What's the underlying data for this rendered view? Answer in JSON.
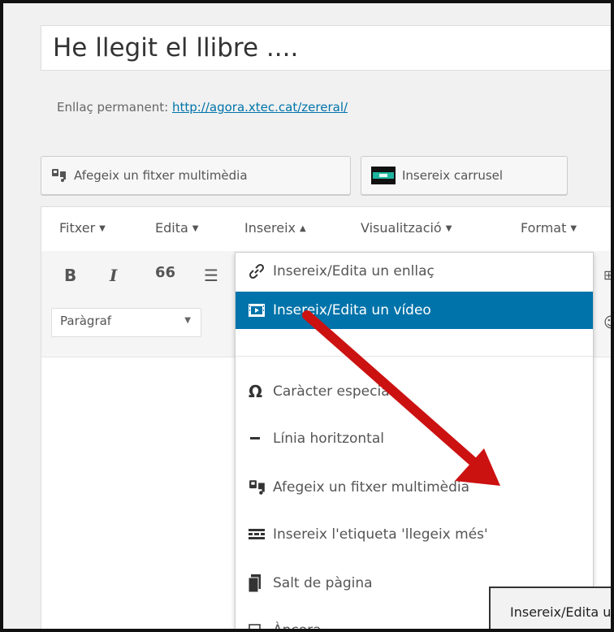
{
  "post": {
    "title": "He llegit el llibre ....",
    "permalink_label": "Enllaç permanent:",
    "permalink_url": "http://agora.xtec.cat/zereral/"
  },
  "media_buttons": {
    "add_media": "Afegeix un fitxer multimèdia",
    "insert_carousel": "Insereix carrusel"
  },
  "menubar": {
    "file": "Fitxer",
    "edit": "Edita",
    "insert": "Insereix",
    "view": "Visualització",
    "format": "Format"
  },
  "toolbar": {
    "bold": "B",
    "italic": "I",
    "quote": "66",
    "format_select": "Paràgraf"
  },
  "insert_menu": {
    "items": [
      {
        "label": "Insereix/Edita un enllaç",
        "icon": "link-icon"
      },
      {
        "label": "Insereix/Edita un vídeo",
        "icon": "video-icon",
        "active": true
      },
      {
        "label": "Caràcter especial",
        "icon": "omega-icon"
      },
      {
        "label": "Línia horitzontal",
        "icon": "horizontal-line-icon"
      },
      {
        "label": "Afegeix un fitxer multimèdia",
        "icon": "media-icon"
      },
      {
        "label": "Insereix l'etiqueta 'llegeix més'",
        "icon": "read-more-icon"
      },
      {
        "label": "Salt de pàgina",
        "icon": "page-break-icon"
      },
      {
        "label": "Àncora",
        "icon": "anchor-icon"
      }
    ]
  },
  "tooltip": "Insereix/Edita un vídeo",
  "colors": {
    "accent": "#0073aa",
    "annotation_arrow": "#cc1111"
  }
}
